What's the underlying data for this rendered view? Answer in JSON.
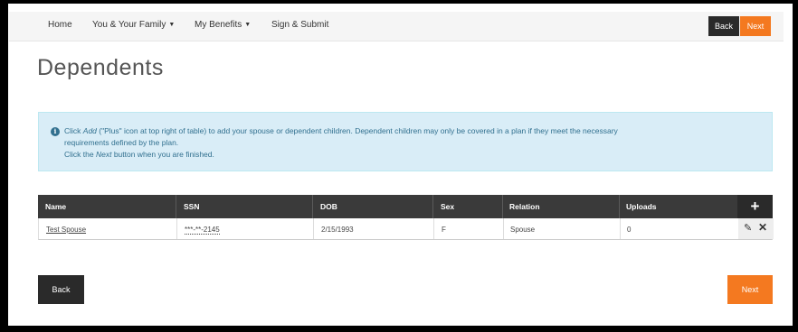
{
  "nav": {
    "home": "Home",
    "family": "You & Your Family",
    "benefits": "My Benefits",
    "sign": "Sign & Submit",
    "back": "Back",
    "next": "Next"
  },
  "page": {
    "title": "Dependents"
  },
  "alert": {
    "line1_pre": "Click ",
    "line1_add": "Add",
    "line1_post": " (\"Plus\" icon at top right of table) to add your spouse or dependent children. Dependent children may only be covered in a plan if they meet the necessary",
    "line2": "requirements defined by the plan.",
    "line3_pre": "Click the ",
    "line3_next": "Next",
    "line3_post": " button when you are finished."
  },
  "table": {
    "headers": [
      "Name",
      "SSN",
      "DOB",
      "Sex",
      "Relation",
      "Uploads"
    ],
    "rows": [
      {
        "name": "Test Spouse",
        "ssn": "***-**-2145",
        "dob": "2/15/1993",
        "sex": "F",
        "relation": "Spouse",
        "uploads": "0"
      }
    ]
  },
  "footer": {
    "back": "Back",
    "next": "Next"
  },
  "colors": {
    "accent": "#f47920",
    "dark": "#2a2a2a",
    "info_bg": "#d9edf7",
    "info_text": "#31708f"
  }
}
